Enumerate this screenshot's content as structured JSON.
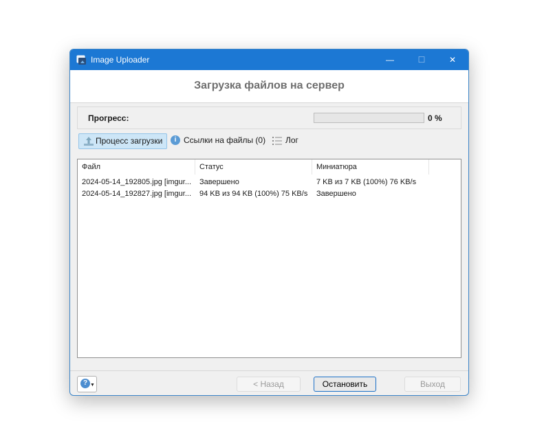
{
  "window": {
    "title": "Image Uploader",
    "controls": {
      "minimize": "—",
      "maximize": "☐",
      "close": "✕"
    }
  },
  "heading": "Загрузка файлов на сервер",
  "progress": {
    "label": "Прогресс:",
    "percent_text": "0 %",
    "value": 0
  },
  "tabs": {
    "upload_process": "Процесс загрузки",
    "links": "Ссылки на файлы (0)",
    "log": "Лог"
  },
  "table": {
    "columns": [
      "Файл",
      "Статус",
      "Миниатюра"
    ],
    "rows": [
      {
        "file": "2024-05-14_192805.jpg [imgur...",
        "status": "Завершено",
        "thumbnail": "7 KB из 7 KB (100%) 76 KB/s"
      },
      {
        "file": "2024-05-14_192827.jpg [imgur...",
        "status": "94 KB из 94 KB (100%) 75 KB/s",
        "thumbnail": "Завершено"
      }
    ]
  },
  "buttons": {
    "back": "< Назад",
    "stop": "Остановить",
    "exit": "Выход"
  },
  "colors": {
    "titlebar": "#1c78d4",
    "accent_border": "#1a6fc7",
    "progress_fill": "#06b025"
  }
}
